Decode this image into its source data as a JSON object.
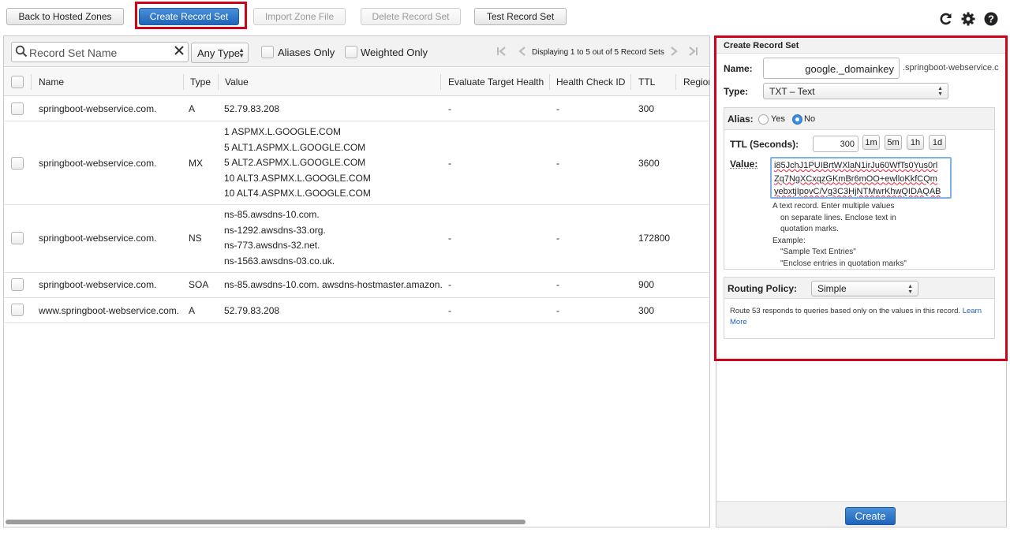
{
  "toolbar": {
    "back": "Back to Hosted Zones",
    "create": "Create Record Set",
    "import": "Import Zone File",
    "delete": "Delete Record Set",
    "test": "Test Record Set"
  },
  "filters": {
    "search_placeholder": "Record Set Name",
    "type": "Any Type",
    "aliases_only": "Aliases Only",
    "weighted_only": "Weighted Only",
    "pagination": "Displaying 1 to 5 out of 5 Record Sets"
  },
  "table": {
    "columns": [
      "Name",
      "Type",
      "Value",
      "Evaluate Target Health",
      "Health Check ID",
      "TTL",
      "Region"
    ],
    "rows": [
      {
        "name": "springboot-webservice.com.",
        "type": "A",
        "values": [
          "52.79.83.208"
        ],
        "eval": "-",
        "hc": "-",
        "ttl": "300"
      },
      {
        "name": "springboot-webservice.com.",
        "type": "MX",
        "values": [
          "1 ASPMX.L.GOOGLE.COM",
          "5 ALT1.ASPMX.L.GOOGLE.COM",
          "5 ALT2.ASPMX.L.GOOGLE.COM",
          "10 ALT3.ASPMX.L.GOOGLE.COM",
          "10 ALT4.ASPMX.L.GOOGLE.COM"
        ],
        "eval": "-",
        "hc": "-",
        "ttl": "3600"
      },
      {
        "name": "springboot-webservice.com.",
        "type": "NS",
        "values": [
          "ns-85.awsdns-10.com.",
          "ns-1292.awsdns-33.org.",
          "ns-773.awsdns-32.net.",
          "ns-1563.awsdns-03.co.uk."
        ],
        "eval": "-",
        "hc": "-",
        "ttl": "172800"
      },
      {
        "name": "springboot-webservice.com.",
        "type": "SOA",
        "values": [
          "ns-85.awsdns-10.com. awsdns-hostmaster.amazon."
        ],
        "eval": "-",
        "hc": "-",
        "ttl": "900"
      },
      {
        "name": "www.springboot-webservice.com.",
        "type": "A",
        "values": [
          "52.79.83.208"
        ],
        "eval": "-",
        "hc": "-",
        "ttl": "300"
      }
    ]
  },
  "panel": {
    "title": "Create Record Set",
    "name_label": "Name:",
    "name_value": "google._domainkey",
    "domain_suffix": ".springboot-webservice.c",
    "type_label": "Type:",
    "type_value": "TXT – Text",
    "alias_label": "Alias:",
    "alias_yes": "Yes",
    "alias_no": "No",
    "ttl_label": "TTL (Seconds):",
    "ttl_value": "300",
    "ttl_buttons": [
      "1m",
      "5m",
      "1h",
      "1d"
    ],
    "value_label": "Value:",
    "value_lines": [
      "i85JchJ1PUIBrtWXlaN1irJu60WfTs0Yus0rl",
      "Zq7NgXCxqzGKmBr6mOO+ewlloKkfCQm",
      "yebxtjIpovC/Vg3C3HjNTMwrKhwQIDAQAB"
    ],
    "help_lines": [
      "A text record. Enter multiple values",
      "on separate lines. Enclose text in",
      "quotation marks.",
      "Example:",
      "\"Sample Text Entries\"",
      "\"Enclose entries in quotation marks\""
    ],
    "routing_label": "Routing Policy:",
    "routing_value": "Simple",
    "routing_help": "Route 53 responds to queries based only on the values in this record.",
    "learn": "Learn",
    "more": "More",
    "create_button": "Create"
  },
  "colors": {
    "primary": "#1f64b8",
    "highlight": "#d0021b",
    "link": "#1f64b8"
  },
  "icons": [
    "refresh-icon",
    "gear-icon",
    "help-icon",
    "search-icon",
    "clear-icon",
    "first-page-icon",
    "prev-page-icon",
    "next-page-icon",
    "last-page-icon"
  ]
}
